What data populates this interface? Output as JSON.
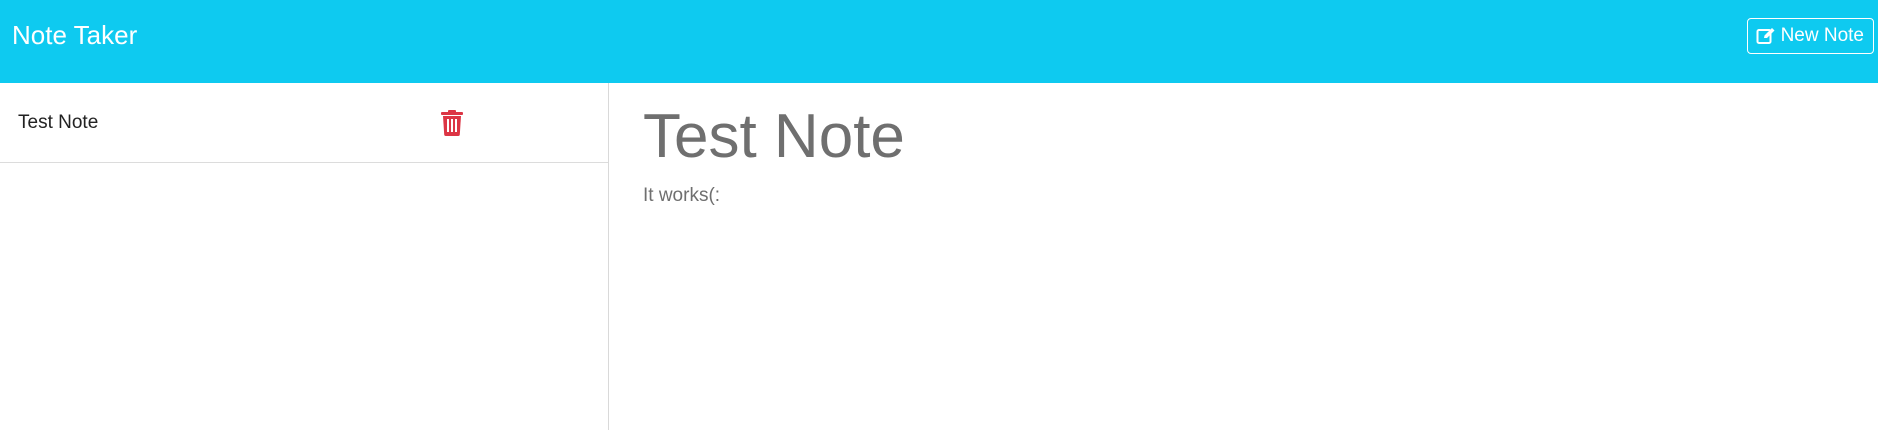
{
  "navbar": {
    "brand": "Note Taker",
    "new_note_label": "New Note",
    "new_note_icon": "edit-icon",
    "background_color": "#0ecaf0"
  },
  "notes": [
    {
      "title": "Test Note",
      "delete_icon": "trash-icon",
      "delete_icon_color": "#dc3545"
    }
  ],
  "editor": {
    "title": "Test Note",
    "text": "It works(:"
  }
}
